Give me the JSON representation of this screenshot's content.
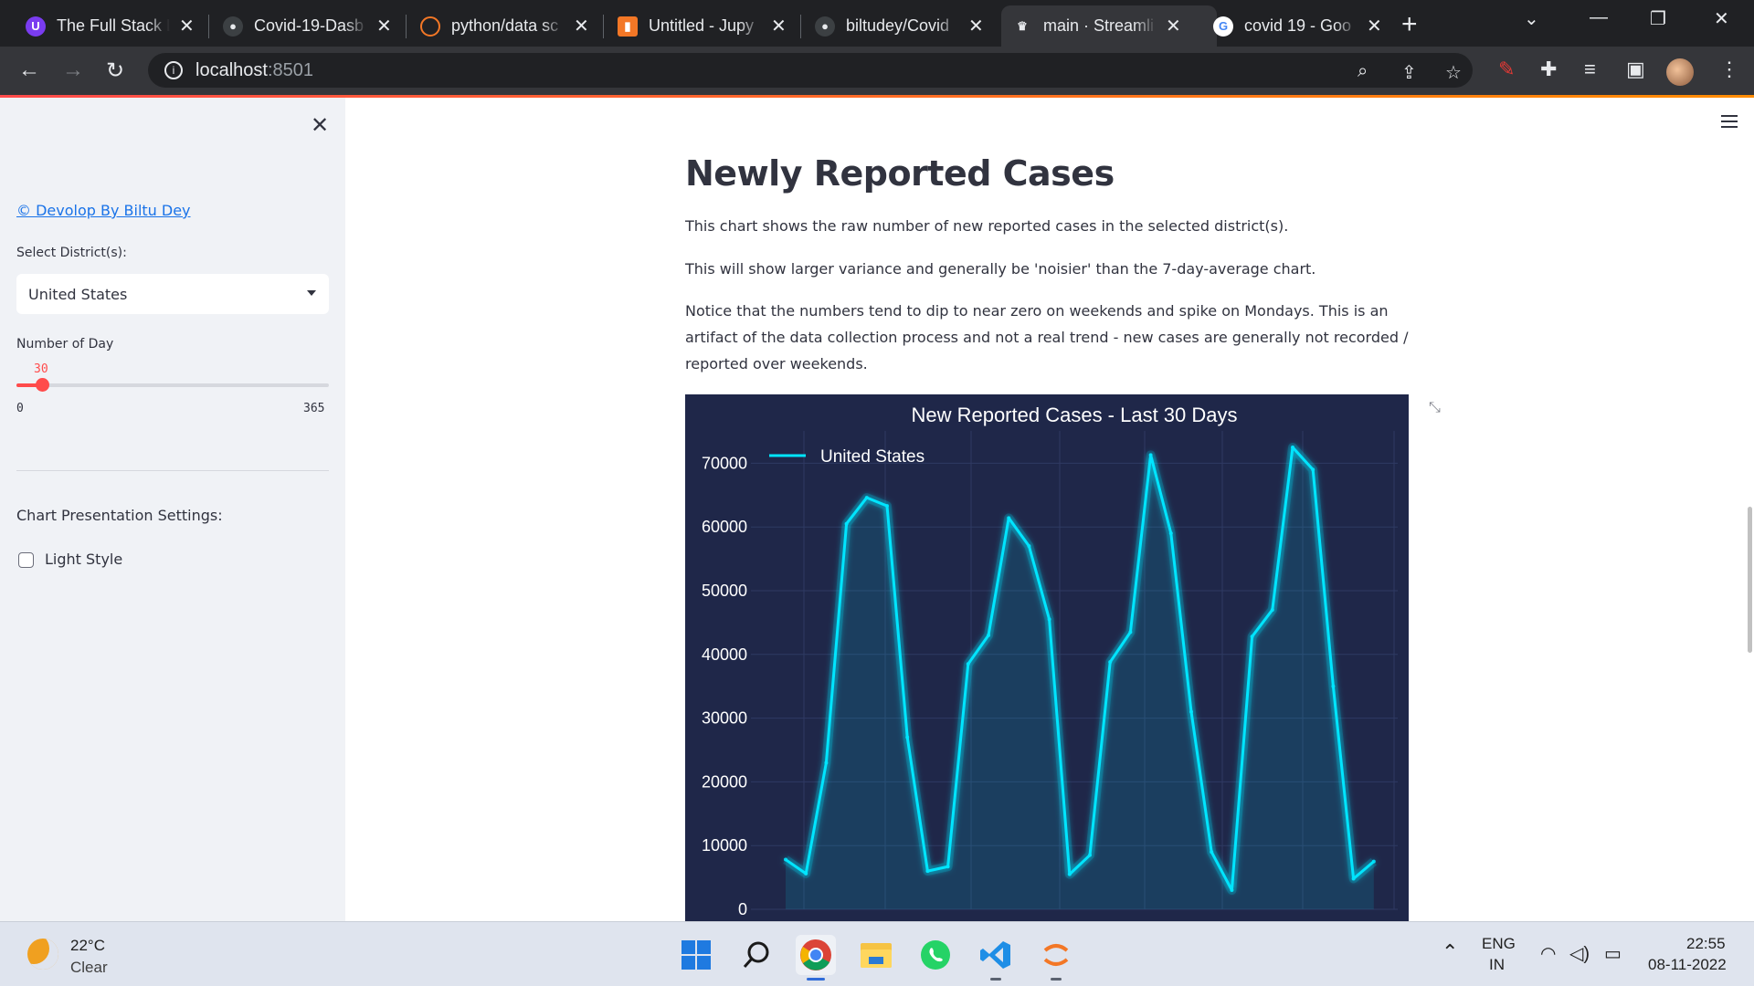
{
  "browser": {
    "tabs": [
      {
        "label": "The Full Stack L",
        "icon": "purple-logo-icon"
      },
      {
        "label": "Covid-19-Dasb",
        "icon": "github-icon"
      },
      {
        "label": "python/data sc",
        "icon": "jupyter-icon"
      },
      {
        "label": "Untitled - Jupy",
        "icon": "jupyter-book-icon"
      },
      {
        "label": "biltudey/Covid",
        "icon": "github-icon"
      },
      {
        "label": "main · Streamli",
        "icon": "streamlit-icon",
        "active": true
      },
      {
        "label": "covid 19 - Goo",
        "icon": "google-icon"
      }
    ],
    "address": {
      "host": "localhost",
      "port": ":8501"
    }
  },
  "sidebar": {
    "link": "© Devolop By Biltu Dey",
    "district_label": "Select District(s):",
    "district_value": "United States",
    "days_label": "Number of Day",
    "slider": {
      "value": "30",
      "min": "0",
      "max": "365",
      "fraction": 0.082
    },
    "settings_heading": "Chart Presentation Settings:",
    "light_style_label": "Light Style"
  },
  "main": {
    "title": "Newly Reported Cases",
    "paragraphs": [
      "This chart shows the raw number of new reported cases in the selected district(s).",
      "This will show larger variance and generally be 'noisier' than the 7-day-average chart.",
      "Notice that the numbers tend to dip to near zero on weekends and spike on Mondays. This is an artifact of the data collection process and not a real trend - new cases are generally not recorded / reported over weekends."
    ]
  },
  "chart_data": {
    "type": "area",
    "title": "New Reported Cases - Last 30 Days",
    "legend": [
      "United States"
    ],
    "legend_position": "top-left",
    "y_ticks": [
      "0",
      "10000",
      "20000",
      "30000",
      "40000",
      "50000",
      "60000",
      "70000"
    ],
    "ylim": [
      0,
      72000
    ],
    "series": [
      {
        "name": "United States",
        "color": "#00e5ff",
        "values": [
          7800,
          5600,
          23000,
          60500,
          64600,
          63300,
          27000,
          6000,
          6700,
          38500,
          43000,
          61400,
          57000,
          45500,
          5500,
          8500,
          38800,
          43500,
          71300,
          59000,
          31000,
          9000,
          3000,
          42800,
          47000,
          72500,
          69000,
          35000,
          4800,
          7500
        ]
      }
    ],
    "background": "#1f2749",
    "grid": true
  },
  "taskbar": {
    "weather": {
      "temp": "22°C",
      "condition": "Clear"
    },
    "apps": [
      "windows-start-icon",
      "search-icon",
      "chrome-icon",
      "file-explorer-icon",
      "whatsapp-icon",
      "vscode-icon",
      "jupyter-icon"
    ],
    "lang": {
      "line1": "ENG",
      "line2": "IN"
    },
    "clock": {
      "time": "22:55",
      "date": "08-11-2022"
    }
  }
}
